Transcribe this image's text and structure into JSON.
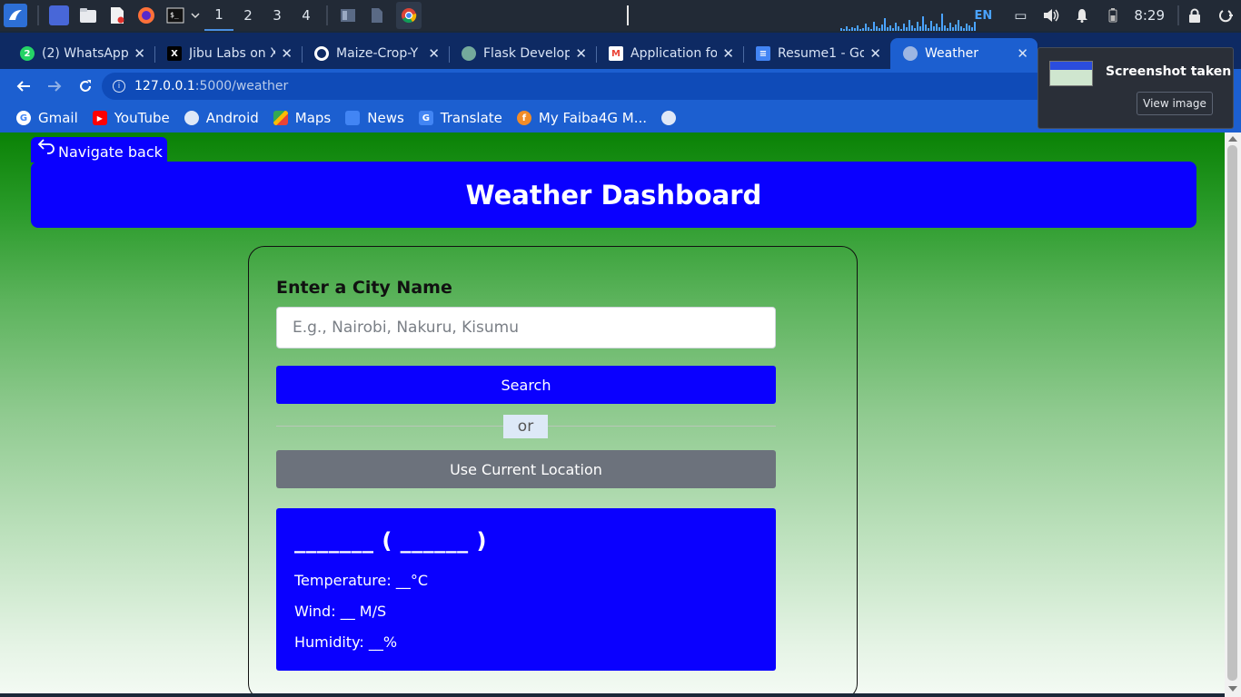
{
  "taskbar": {
    "workspaces": [
      "1",
      "2",
      "3",
      "4"
    ],
    "active_workspace": "1",
    "language": "EN",
    "clock": "8:29"
  },
  "browser": {
    "tabs": [
      {
        "title": "(2) WhatsApp",
        "icon": "whatsapp-icon",
        "color": "#25d366",
        "badge": "2"
      },
      {
        "title": "Jibu Labs on X",
        "icon": "x-icon",
        "color": "#000000",
        "badge": "X"
      },
      {
        "title": "Maize-Crop-Y",
        "icon": "github-icon",
        "color": "#ffffff",
        "badge": ""
      },
      {
        "title": "Flask Develop",
        "icon": "chatgpt-icon",
        "color": "#74aa9c",
        "badge": ""
      },
      {
        "title": "Application fo",
        "icon": "gmail-icon",
        "color": "#ea4335",
        "badge": "M"
      },
      {
        "title": "Resume1 - Go",
        "icon": "docs-icon",
        "color": "#4285f4",
        "badge": "≡"
      },
      {
        "title": "Weather",
        "icon": "globe-icon",
        "color": "#9db6e3",
        "badge": "",
        "active": true
      }
    ],
    "url_host": "127.0.0.1",
    "url_path": ":5000/weather",
    "bookmarks": [
      {
        "label": "Gmail",
        "icon": "google-icon",
        "color": "#ffffff",
        "badge": "G"
      },
      {
        "label": "YouTube",
        "icon": "youtube-icon",
        "color": "#ff0000",
        "badge": "▶"
      },
      {
        "label": "Android",
        "icon": "globe-icon",
        "color": "#dfe8f7",
        "badge": ""
      },
      {
        "label": "Maps",
        "icon": "maps-icon",
        "color": "#34a853",
        "badge": ""
      },
      {
        "label": "News",
        "icon": "news-icon",
        "color": "#4285f4",
        "badge": ""
      },
      {
        "label": "Translate",
        "icon": "translate-icon",
        "color": "#4285f4",
        "badge": "G"
      },
      {
        "label": "My Faiba4G M...",
        "icon": "faiba-icon",
        "color": "#f28c28",
        "badge": "f"
      }
    ]
  },
  "toast": {
    "title": "Screenshot taken",
    "action": "View image"
  },
  "page": {
    "back_label": "Navigate back",
    "title": "Weather Dashboard",
    "city_label": "Enter a City Name",
    "city_placeholder": "E.g., Nairobi, Nakuru, Kisumu",
    "search_label": "Search",
    "or_label": "or",
    "location_label": "Use Current Location",
    "result": {
      "place": "_______ ( ______ )",
      "temperature": "Temperature: __°C",
      "wind": "Wind: __ M/S",
      "humidity": "Humidity: __%"
    },
    "colors": {
      "primary": "#0a00ff",
      "secondary_button": "#6c727c",
      "background_top": "#0a8205",
      "background_bottom": "#f3faf3"
    }
  }
}
